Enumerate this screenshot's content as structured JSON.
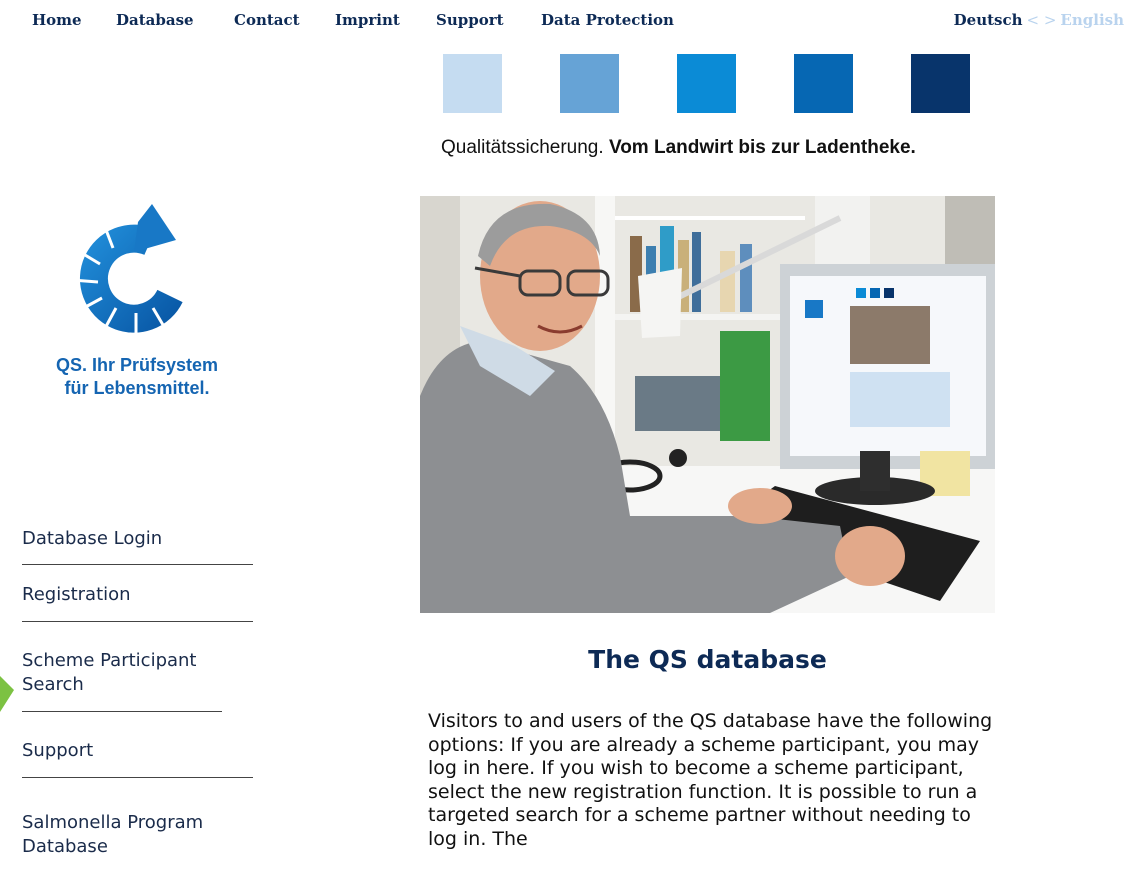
{
  "nav": {
    "items": [
      "Home",
      "Database",
      "Contact",
      "Imprint",
      "Support",
      "Data Protection"
    ],
    "lang_de": "Deutsch",
    "lang_sep": "< >",
    "lang_en": "English"
  },
  "header": {
    "squares": [
      "#c5dcf1",
      "#66a3d6",
      "#0b8bd6",
      "#0667b3",
      "#08346b"
    ],
    "tagline_normal": "Qualitätssicherung.",
    "tagline_bold": "Vom Landwirt bis zur Ladentheke."
  },
  "logo": {
    "line1": "QS. Ihr Prüfsystem",
    "line2": "für Lebensmittel."
  },
  "sidebar": {
    "items": [
      {
        "label": "Database Login"
      },
      {
        "label": "Registration"
      },
      {
        "label": "Scheme Participant Search"
      },
      {
        "label": "Support"
      },
      {
        "label": "Salmonella Program Database"
      }
    ]
  },
  "main": {
    "title": "The QS database",
    "body": "Visitors to and users of the QS database have the following options: If you are already a scheme participant, you may log in here. If you wish to become a scheme participant, select the new registration function. It is possible to run a targeted search for a scheme partner without needing to log in. The"
  },
  "colors": {
    "navy": "#0d2a55",
    "logo_blue": "#1565b2",
    "accent_green": "#7cc242"
  }
}
